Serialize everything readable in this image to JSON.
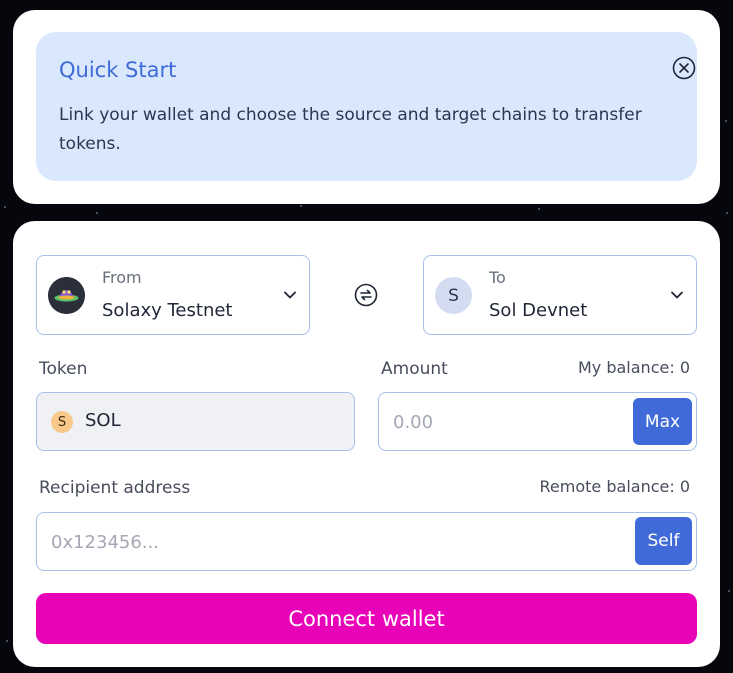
{
  "colors": {
    "accent": "#3f6ad8",
    "primary_button": "#e803b8",
    "banner_bg": "#d9e8fc",
    "border": "#a9c1ea"
  },
  "quick_start": {
    "title": "Quick Start",
    "text": "Link your wallet and choose the source and target chains to transfer tokens.",
    "close_icon": "close-circle-icon"
  },
  "from_chain": {
    "label": "From",
    "name": "Solaxy Testnet",
    "icon": "solaxy-logo"
  },
  "to_chain": {
    "label": "To",
    "name": "Sol Devnet",
    "icon_letter": "S"
  },
  "swap_icon": "swap-arrows-icon",
  "token": {
    "label": "Token",
    "icon_letter": "S",
    "name": "SOL"
  },
  "amount": {
    "label": "Amount",
    "balance": "My balance: 0",
    "placeholder": "0.00",
    "value": "",
    "max_label": "Max"
  },
  "recipient": {
    "label": "Recipient address",
    "balance": "Remote balance: 0",
    "placeholder": "0x123456...",
    "value": "",
    "self_label": "Self"
  },
  "connect_label": "Connect wallet"
}
